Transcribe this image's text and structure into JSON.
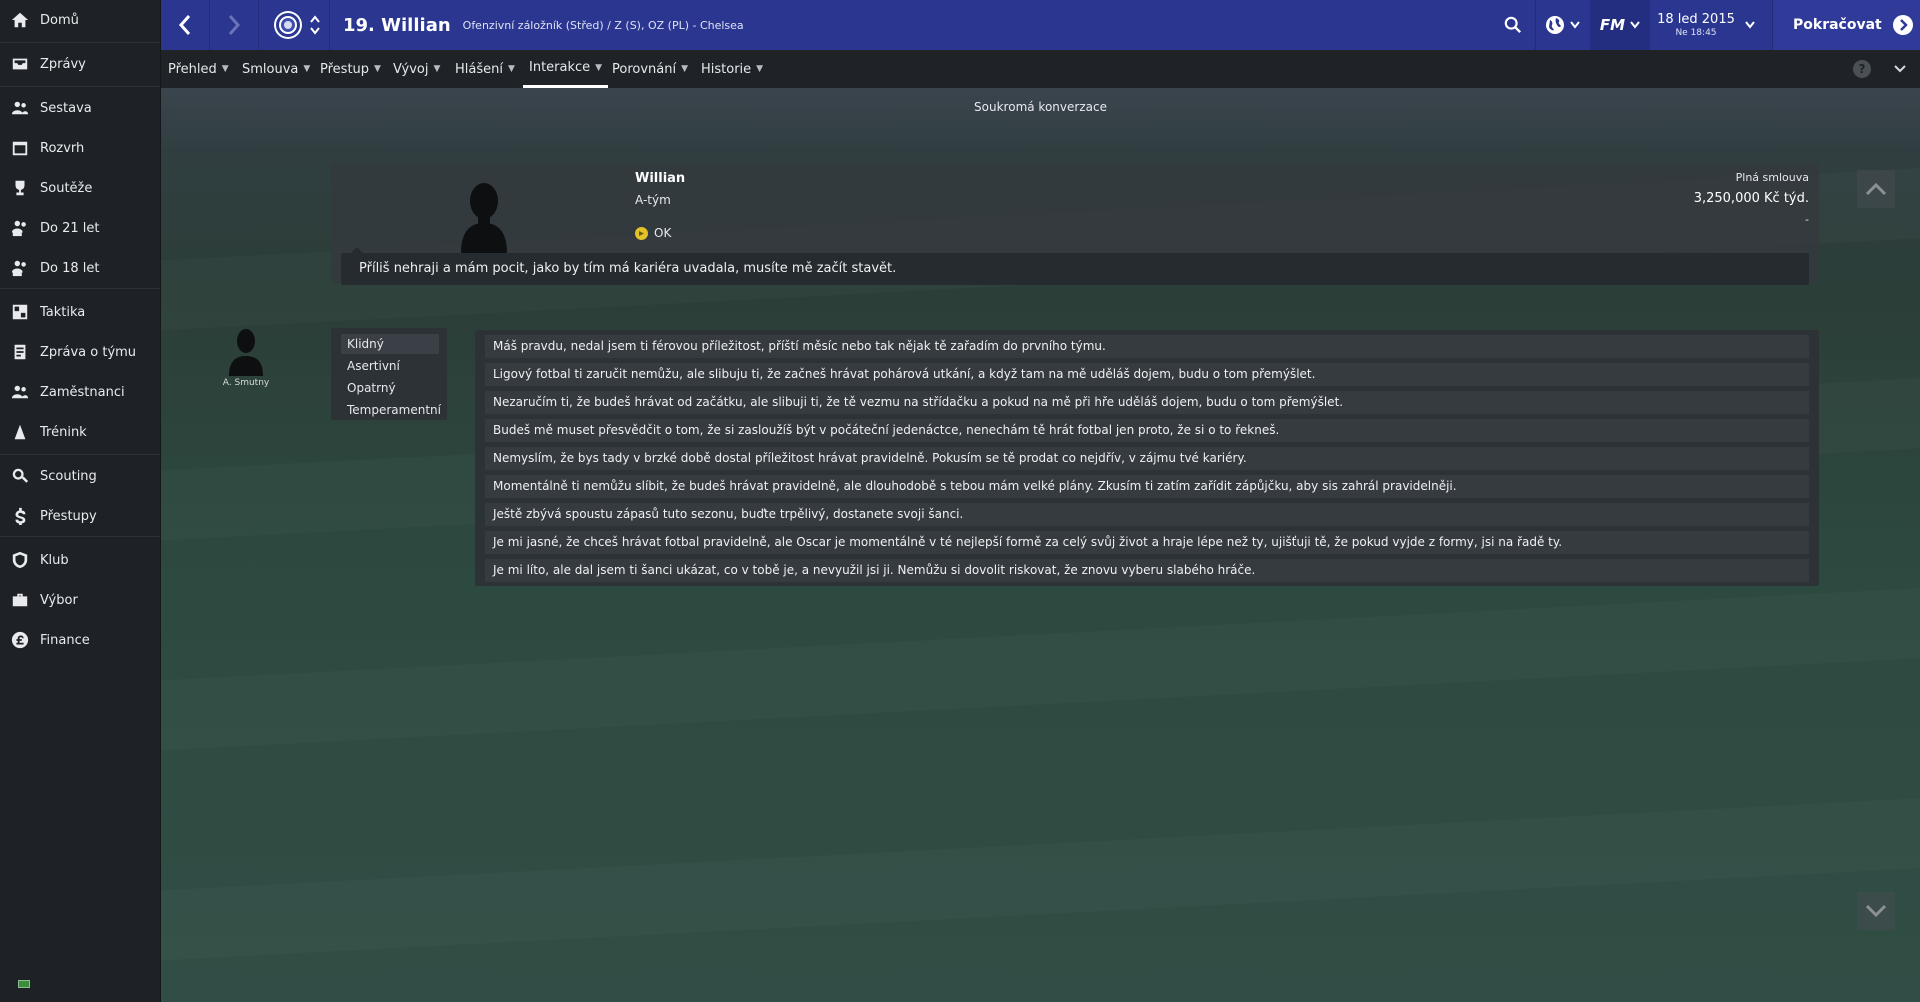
{
  "sidebar": {
    "items": [
      {
        "label": "Domů",
        "icon": "home-icon"
      },
      {
        "label": "Zprávy",
        "icon": "inbox-icon"
      },
      {
        "label": "Sestava",
        "icon": "squad-icon"
      },
      {
        "label": "Rozvrh",
        "icon": "calendar-icon"
      },
      {
        "label": "Soutěže",
        "icon": "trophy-icon"
      },
      {
        "label": "Do 21 let",
        "icon": "u21-icon"
      },
      {
        "label": "Do 18 let",
        "icon": "u18-icon"
      },
      {
        "label": "Taktika",
        "icon": "tactics-icon"
      },
      {
        "label": "Zpráva o týmu",
        "icon": "team-report-icon"
      },
      {
        "label": "Zaměstnanci",
        "icon": "staff-icon"
      },
      {
        "label": "Trénink",
        "icon": "training-icon"
      },
      {
        "label": "Scouting",
        "icon": "scouting-icon"
      },
      {
        "label": "Přestupy",
        "icon": "transfers-icon"
      },
      {
        "label": "Klub",
        "icon": "club-icon"
      },
      {
        "label": "Výbor",
        "icon": "board-icon"
      },
      {
        "label": "Finance",
        "icon": "finance-icon"
      }
    ]
  },
  "topbar": {
    "player_name": "19. Willian",
    "player_subtitle": "Ofenzivní záložník (Střed) / Z (S), OZ (PL) - Chelsea",
    "fm_label": "FM",
    "date": "18 led 2015",
    "time": "Ne 18:45",
    "continue_label": "Pokračovat"
  },
  "subnav": {
    "tabs": [
      {
        "label": "Přehled"
      },
      {
        "label": "Smlouva"
      },
      {
        "label": "Přestup"
      },
      {
        "label": "Vývoj"
      },
      {
        "label": "Hlášení"
      },
      {
        "label": "Interakce",
        "active": true
      },
      {
        "label": "Porovnání"
      },
      {
        "label": "Historie"
      }
    ],
    "help": "?"
  },
  "conversation": {
    "title": "Soukromá konverzace",
    "player": {
      "name": "Willian",
      "squad": "A-tým",
      "status": "OK",
      "contract_type": "Plná smlouva",
      "wage": "3,250,000 Kč týd.",
      "extra": "-"
    },
    "quote": "Příliš nehraji a mám pocit, jako by tím má kariéra uvadala, musíte mě začít stavět.",
    "manager_name": "A. Smutny",
    "tones": [
      "Klidný",
      "Asertivní",
      "Opatrný",
      "Temperamentní"
    ],
    "selected_tone": "Klidný",
    "responses": [
      "Máš pravdu, nedal jsem ti férovou příležitost, příští měsíc nebo tak nějak tě zařadím do prvního týmu.",
      "Ligový fotbal ti zaručit nemůžu, ale slibuju ti, že začneš hrávat pohárová utkání, a když tam na mě uděláš dojem, budu o tom přemýšlet.",
      "Nezaručím ti, že budeš hrávat od začátku, ale slibuji ti, že tě vezmu na střídačku a pokud na mě při hře uděláš dojem, budu o tom přemýšlet.",
      "Budeš mě muset přesvědčit o tom, že si zasloužíš být v počáteční jedenáctce, nenechám tě hrát fotbal jen proto, že si o to řekneš.",
      "Nemyslím, že bys tady v brzké době dostal příležitost hrávat pravidelně. Pokusím se tě prodat co nejdřív, v zájmu tvé kariéry.",
      "Momentálně ti nemůžu slíbit, že budeš hrávat pravidelně, ale dlouhodobě s tebou mám velké plány. Zkusím ti zatím zařídit zápůjčku, aby sis zahrál pravidelněji.",
      "Ještě zbývá spoustu zápasů tuto sezonu, buďte trpělivý, dostanete svoji šanci.",
      "Je mi jasné, že chceš hrávat fotbal pravidelně, ale Oscar je momentálně v té nejlepší formě za celý svůj život a hraje lépe než ty, ujišťuji tě, že pokud vyjde z formy, jsi na řadě ty.",
      "Je mi líto, ale dal jsem ti šanci ukázat, co v tobě je, a nevyužil jsi ji. Nemůžu si dovolit riskovat, že znovu vyberu slabého hráče."
    ]
  },
  "colors": {
    "topbar": "#2b3691",
    "sidebar": "#1e2226",
    "status_ok": "#e3c128"
  }
}
